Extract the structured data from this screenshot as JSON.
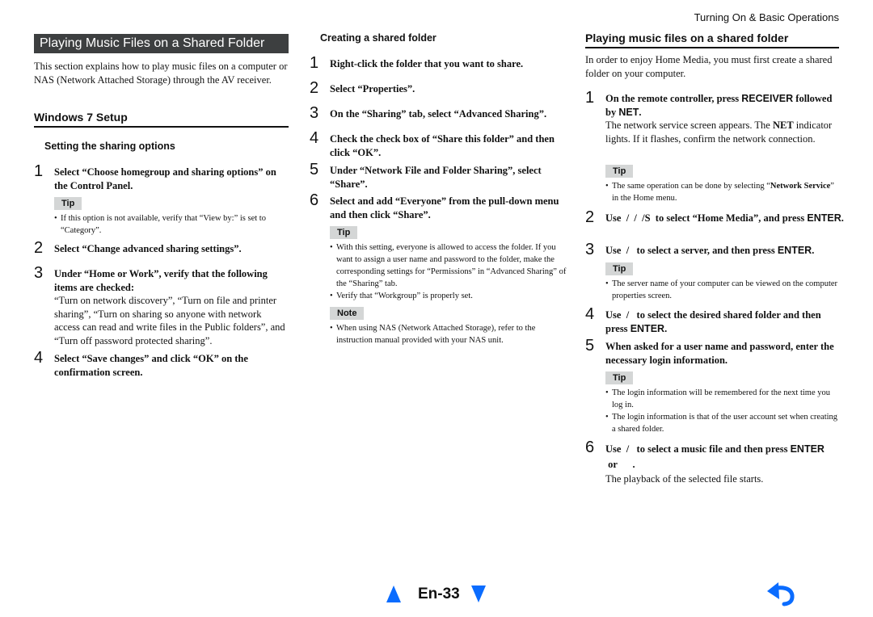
{
  "header": {
    "section_title": "Turning On & Basic Operations"
  },
  "left": {
    "banner": "Playing Music Files on a Shared Folder",
    "intro": "This section explains how to play music files on a computer or NAS (Network Attached Storage) through the AV receiver.",
    "heading": "Windows 7 Setup",
    "subheading": "Setting the sharing options",
    "steps": [
      {
        "num": "1",
        "text": "Select “Choose homegroup and sharing options” on the Control Panel."
      },
      {
        "num": "2",
        "text": "Select “Change advanced sharing settings”."
      },
      {
        "num": "3",
        "text": "Under “Home or Work”, verify that the following items are checked:",
        "body": "“Turn on network discovery”, “Turn on file and printer sharing”, “Turn on sharing so anyone with network access can read and write files in the Public folders”, and “Turn off password protected sharing”."
      },
      {
        "num": "4",
        "text": "Select “Save changes” and click “OK” on the confirmation screen."
      }
    ],
    "tip_label": "Tip",
    "tip": "If this option is not available, verify that “View by:” is set to “Category”."
  },
  "middle": {
    "subheading": "Creating a shared folder",
    "steps": [
      {
        "num": "1",
        "text": "Right-click the folder that you want to share."
      },
      {
        "num": "2",
        "text": "Select “Properties”."
      },
      {
        "num": "3",
        "text": "On the “Sharing” tab, select “Advanced Sharing”."
      },
      {
        "num": "4",
        "text": "Check the check box of “Share this folder” and then click “OK”."
      },
      {
        "num": "5",
        "text": "Under “Network File and Folder Sharing”, select “Share”."
      },
      {
        "num": "6",
        "text": "Select and add “Everyone” from the pull-down menu and then click “Share”."
      }
    ],
    "tip_label": "Tip",
    "tips": [
      "With this setting, everyone is allowed to access the folder. If you want to assign a user name and password to the folder, make the corresponding settings for “Permissions” in “Advanced Sharing” of the “Sharing” tab.",
      "Verify that “Workgroup” is properly set."
    ],
    "note_label": "Note",
    "notes": [
      "When using NAS (Network Attached Storage), refer to the instruction manual provided with your NAS unit."
    ]
  },
  "right": {
    "heading": "Playing music files on a shared folder",
    "intro": "In order to enjoy Home Media, you must first create a shared folder on your computer.",
    "step1": {
      "num": "1",
      "text_a": "On the remote controller, press ",
      "kw_a": "RECEIVER",
      "text_b": " followed by ",
      "kw_b": "NET",
      "text_c": ".",
      "body_a": "The network service screen appears. The ",
      "body_kw": "NET",
      "body_b": " indicator lights. If it flashes, confirm the network connection."
    },
    "tip1_label": "Tip",
    "tip1_a": "The same operation can be done by selecting “",
    "tip1_kw": "Network Service",
    "tip1_b": "” in the Home menu.",
    "step2": {
      "num": "2",
      "text": "Use  /  /  /S  to select “Home Media”, and press ",
      "kw": "ENTER",
      "end": "."
    },
    "step3": {
      "num": "3",
      "text": "Use  /   to select a server, and then press ",
      "kw": "ENTER",
      "end": "."
    },
    "tip2_label": "Tip",
    "tip2": "The server name of your computer can be viewed on the computer properties screen.",
    "step4": {
      "num": "4",
      "text": "Use  /   to select the desired shared folder and then press ",
      "kw": "ENTER",
      "end": "."
    },
    "step5": {
      "num": "5",
      "text": "When asked for a user name and password, enter the necessary login information."
    },
    "tip3_label": "Tip",
    "tips3": [
      "The login information will be remembered for the next time you log in.",
      "The login information is that of the user account set when creating a shared folder."
    ],
    "step6": {
      "num": "6",
      "text": "Use  /   to select a music file and then press ",
      "kw": "ENTER",
      "end": " or      .",
      "body": "The playback of the selected file starts."
    }
  },
  "footer": {
    "page_label": "En-33"
  },
  "colors": {
    "accent": "#0a6cff",
    "banner_bg": "#3d3f40",
    "badge_bg": "#d4d6d6"
  }
}
